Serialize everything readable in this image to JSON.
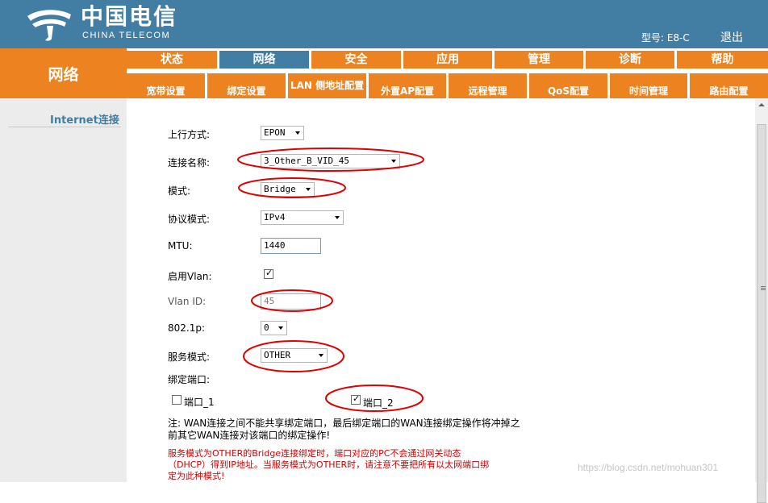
{
  "header": {
    "logo_cn": "中国电信",
    "logo_en": "CHINA TELECOM",
    "model_label": "型号: E8-C",
    "logout": "退出"
  },
  "section_title": "网络",
  "tabs": [
    {
      "label": "状态"
    },
    {
      "label": "网络",
      "active": true
    },
    {
      "label": "安全"
    },
    {
      "label": "应用"
    },
    {
      "label": "管理"
    },
    {
      "label": "诊断"
    },
    {
      "label": "帮助"
    }
  ],
  "subtabs": [
    {
      "label": "宽带设置",
      "active": true
    },
    {
      "label": "绑定设置"
    },
    {
      "label": "LAN 侧地址配置"
    },
    {
      "label": "外置AP配置"
    },
    {
      "label": "远程管理"
    },
    {
      "label": "QoS配置"
    },
    {
      "label": "时间管理"
    },
    {
      "label": "路由配置"
    }
  ],
  "sidebar": {
    "item": "Internet连接"
  },
  "form": {
    "uplink_label": "上行方式:",
    "uplink_value": "EPON",
    "conn_name_label": "连接名称:",
    "conn_name_value": "3_Other_B_VID_45",
    "mode_label": "模式:",
    "mode_value": "Bridge",
    "protocol_label": "协议模式:",
    "protocol_value": "IPv4",
    "mtu_label": "MTU:",
    "mtu_value": "1440",
    "vlan_enable_label": "启用Vlan:",
    "vlan_enabled": true,
    "vlan_id_label": "Vlan ID:",
    "vlan_id_value": "45",
    "dot1p_label": "802.1p:",
    "dot1p_value": "0",
    "service_mode_label": "服务模式:",
    "service_mode_value": "OTHER",
    "bind_port_label": "绑定端口:",
    "port1_label": "端口_1",
    "port1_checked": false,
    "port2_label": "端口_2",
    "port2_checked": true
  },
  "notes": {
    "note1_line1": "注: WAN连接之间不能共享绑定端口，最后绑定端口的WAN连接绑定操作将冲掉之",
    "note1_line2": "前其它WAN连接对该端口的绑定操作!",
    "warn_line1": "服务模式为OTHER的Bridge连接绑定时，端口对应的PC不会通过网关动态",
    "warn_line2": "（DHCP）得到IP地址。当服务模式为OTHER时，请注意不要把所有以太网端口绑",
    "warn_line3": "定为此种模式!"
  },
  "watermark": "https://blog.csdn.net/mohuan301",
  "colors": {
    "header_blue": "#427ea3",
    "nav_orange": "#ed8320",
    "annotation_red": "#e00000",
    "warning_red": "#d10000"
  }
}
